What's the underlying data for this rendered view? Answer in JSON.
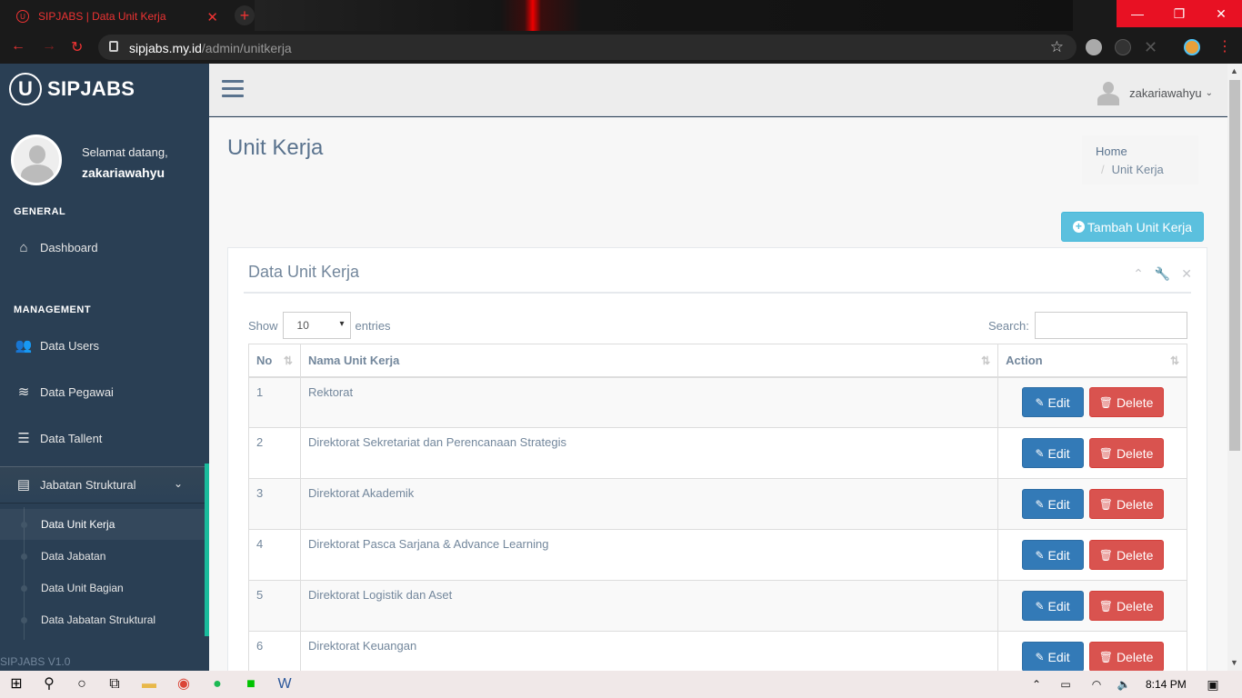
{
  "browser": {
    "tab_title": "SIPJABS | Data Unit Kerja",
    "url_domain": "sipjabs.my.id",
    "url_path": "/admin/unitkerja"
  },
  "sidebar": {
    "brand": "SIPJABS",
    "welcome": "Selamat datang,",
    "username": "zakariawahyu",
    "section_general": "GENERAL",
    "section_management": "MANAGEMENT",
    "items": [
      {
        "label": "Dashboard",
        "icon": "home-icon"
      },
      {
        "label": "Data Users",
        "icon": "users-icon"
      },
      {
        "label": "Data Pegawai",
        "icon": "database-icon"
      },
      {
        "label": "Data Tallent",
        "icon": "list-icon"
      },
      {
        "label": "Jabatan Struktural",
        "icon": "newspaper-icon"
      }
    ],
    "subitems": [
      {
        "label": "Data Unit Kerja"
      },
      {
        "label": "Data Jabatan"
      },
      {
        "label": "Data Unit Bagian"
      },
      {
        "label": "Data Jabatan Struktural"
      }
    ],
    "version": "SIPJABS V1.0"
  },
  "topnav": {
    "username": "zakariawahyu"
  },
  "main": {
    "page_title": "Unit Kerja",
    "breadcrumb": {
      "home": "Home",
      "current": "Unit Kerja"
    },
    "add_button": "Tambah Unit Kerja",
    "panel_title": "Data Unit Kerja",
    "show_label": "Show",
    "entries_value": "10",
    "entries_label": "entries",
    "search_label": "Search:",
    "columns": {
      "no": "No",
      "name": "Nama Unit Kerja",
      "action": "Action"
    },
    "edit_label": "Edit",
    "delete_label": "Delete",
    "rows": [
      {
        "no": "1",
        "name": "Rektorat"
      },
      {
        "no": "2",
        "name": "Direktorat Sekretariat dan Perencanaan Strategis"
      },
      {
        "no": "3",
        "name": "Direktorat Akademik"
      },
      {
        "no": "4",
        "name": "Direktorat Pasca Sarjana & Advance Learning"
      },
      {
        "no": "5",
        "name": "Direktorat Logistik dan Aset"
      },
      {
        "no": "6",
        "name": "Direktorat Keuangan"
      }
    ]
  },
  "taskbar": {
    "time": "8:14 PM"
  }
}
